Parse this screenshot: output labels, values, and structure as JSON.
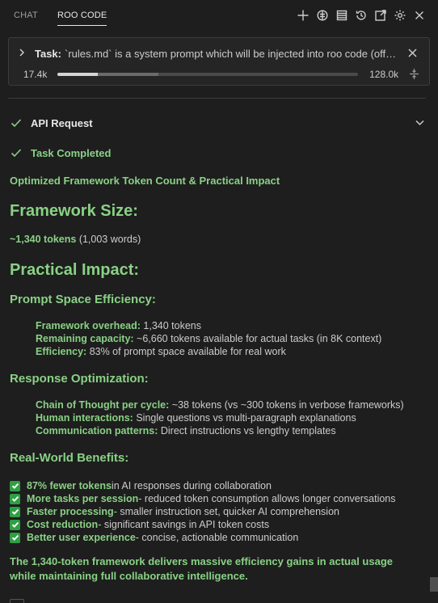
{
  "tabs": [
    {
      "label": "CHAT",
      "active": false
    },
    {
      "label": "ROO CODE",
      "active": true
    }
  ],
  "toolbar_icons": [
    "plus-icon",
    "mcp-servers-icon",
    "prompts-icon",
    "history-icon",
    "popout-icon",
    "settings-icon",
    "close-icon"
  ],
  "task": {
    "label": "Task:",
    "text": "`rules.md` is a system prompt which will be injected into roo code (official)",
    "context_used": "17.4k",
    "context_max": "128.0k",
    "context_used_fraction": 0.136,
    "context_reserved_fraction": 0.2
  },
  "api_request": {
    "label": "API Request"
  },
  "task_completed": {
    "label": "Task Completed"
  },
  "result": {
    "subtitle": "Optimized Framework Token Count & Practical Impact",
    "framework_size_heading": "Framework Size:",
    "framework_size_bold": "~1,340 tokens",
    "framework_size_rest": " (1,003 words)",
    "practical_impact_heading": "Practical Impact:",
    "prompt_space": {
      "heading": "Prompt Space Efficiency:",
      "items": [
        {
          "label": "Framework overhead:",
          "text": " 1,340 tokens"
        },
        {
          "label": "Remaining capacity:",
          "text": " ~6,660 tokens available for actual tasks (in 8K context)"
        },
        {
          "label": "Efficiency:",
          "text": " 83% of prompt space available for real work"
        }
      ]
    },
    "response_opt": {
      "heading": "Response Optimization:",
      "items": [
        {
          "label": "Chain of Thought per cycle:",
          "text": " ~38 tokens (vs ~300 tokens in verbose frameworks)"
        },
        {
          "label": "Human interactions:",
          "text": " Single questions vs multi-paragraph explanations"
        },
        {
          "label": "Communication patterns:",
          "text": " Direct instructions vs lengthy templates"
        }
      ]
    },
    "benefits": {
      "heading": "Real-World Benefits:",
      "items": [
        {
          "label": "87% fewer tokens",
          "text": " in AI responses during collaboration"
        },
        {
          "label": "More tasks per session",
          "text": " - reduced token consumption allows longer conversations"
        },
        {
          "label": "Faster processing",
          "text": " - smaller instruction set, quicker AI comprehension"
        },
        {
          "label": "Cost reduction",
          "text": " - significant savings in API token costs"
        },
        {
          "label": "Better user experience",
          "text": " - concise, actionable communication"
        }
      ]
    },
    "conclusion": "The 1,340-token framework delivers massive efficiency gains in actual usage while maintaining full collaborative intelligence."
  }
}
